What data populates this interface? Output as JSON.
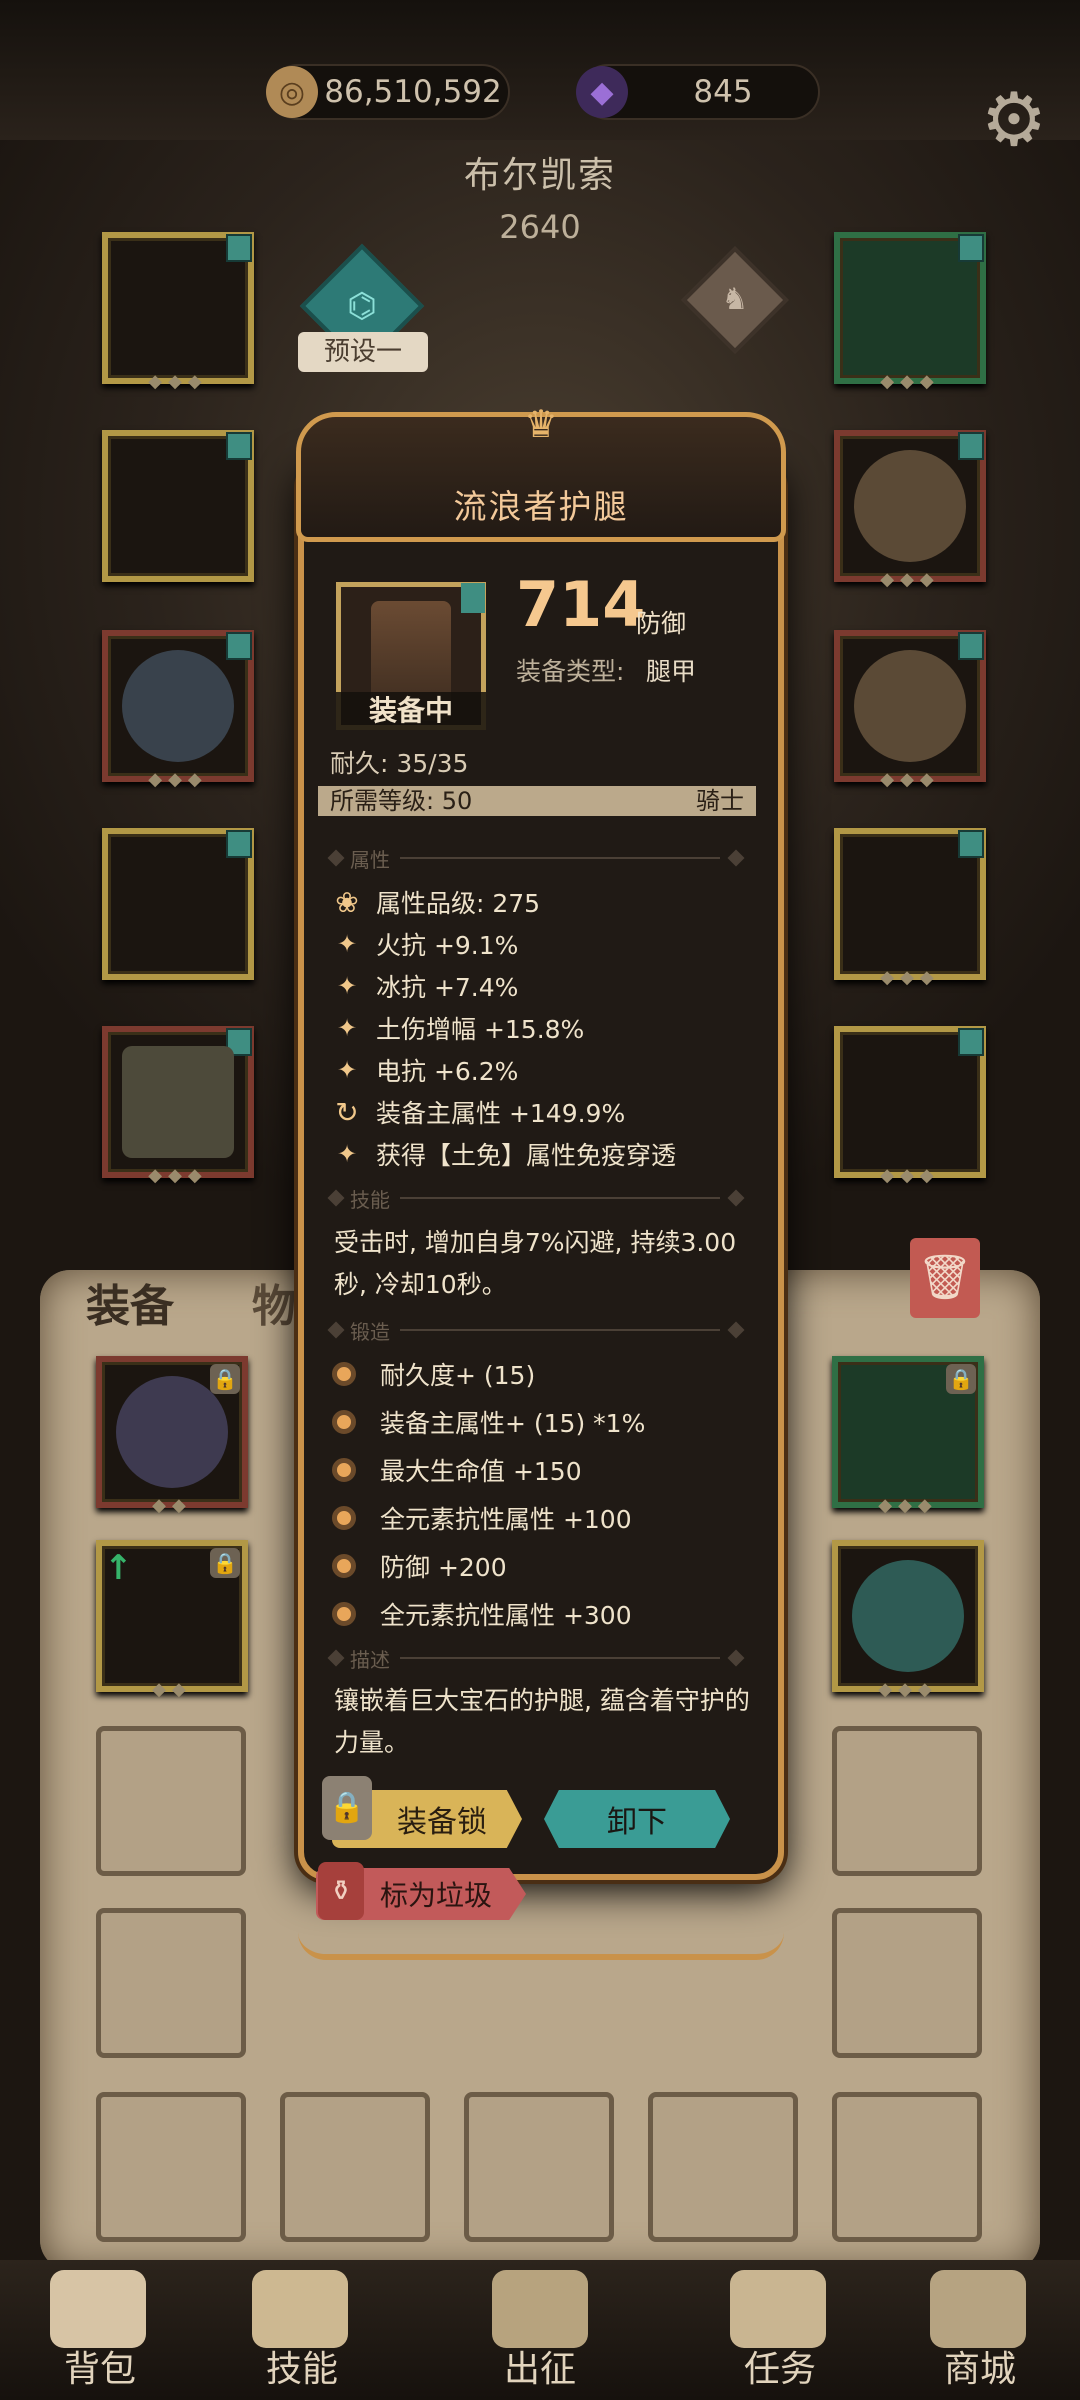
{
  "resources": {
    "coins": "86,510,592",
    "coin_icon": "coin-icon",
    "gems": "845",
    "gem_icon": "purple-crystal-icon"
  },
  "hero": {
    "name": "布尔凯索",
    "power": "2640",
    "preset": "预设一"
  },
  "tabs": {
    "equipment": "装备",
    "items": "物品"
  },
  "nav": [
    "背包",
    "技能",
    "出征",
    "任务",
    "商城"
  ],
  "item": {
    "name": "流浪者护腿",
    "defense_value": "714",
    "defense_label": "防御",
    "type_label": "装备类型:",
    "type_value": "腿甲",
    "equipped_label": "装备中",
    "durability": "耐久: 35/35",
    "required_level": "所需等级: 50",
    "class": "骑士",
    "section_attributes": "属性",
    "attributes": [
      "属性品级: 275",
      "火抗 +9.1%",
      "冰抗 +7.4%",
      "土伤增幅 +15.8%",
      "电抗 +6.2%",
      "装备主属性 +149.9%",
      "获得【土免】属性免疫穿透"
    ],
    "section_skill": "技能",
    "skill_text": "受击时, 增加自身7%闪避, 持续3.00秒, 冷却10秒。",
    "section_forge": "锻造",
    "forge": [
      "耐久度+ (15)",
      "装备主属性+ (15) *1%",
      "最大生命值 +150",
      "全元素抗性属性 +100",
      "防御 +200",
      "全元素抗性属性 +300"
    ],
    "section_desc": "描述",
    "description": "镶嵌着巨大宝石的护腿, 蕴含着守护的力量。",
    "btn_lock": "装备锁",
    "btn_unequip": "卸下",
    "btn_trash": "标为垃圾"
  },
  "colors": {
    "accent": "#c9924a",
    "title": "#f3c99a",
    "teal": "#3a9c95",
    "gold_btn": "#d9b458",
    "red_btn": "#c25a5a"
  }
}
